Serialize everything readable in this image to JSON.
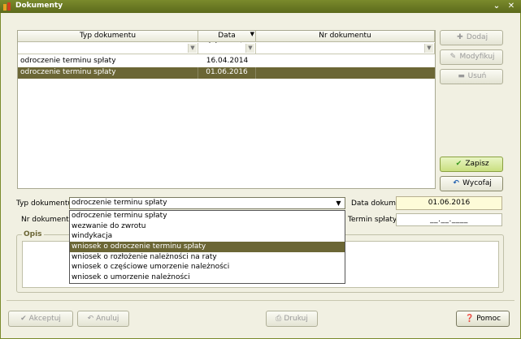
{
  "window": {
    "title": "Dokumenty",
    "minimize_glyph": "⌄",
    "close_glyph": "✕"
  },
  "grid": {
    "columns": [
      {
        "label": "Typ dokumentu",
        "sorted": false
      },
      {
        "label": "Data dokumentu",
        "sorted": true
      },
      {
        "label": "Nr dokumentu",
        "sorted": false
      }
    ],
    "rows": [
      {
        "typ": "odroczenie terminu spłaty",
        "data": "16.04.2014",
        "nr": ""
      },
      {
        "typ": "odroczenie terminu spłaty",
        "data": "01.06.2016",
        "nr": "",
        "selected": true
      }
    ]
  },
  "side_buttons": {
    "dodaj": "Dodaj",
    "modyfikuj": "Modyfikuj",
    "usun": "Usuń",
    "zapisz": "Zapisz",
    "wycofaj": "Wycofaj"
  },
  "form": {
    "typ_label": "Typ dokumentu:",
    "typ_value": "odroczenie terminu spłaty",
    "data_label": "Data dokum.:",
    "data_value": "01.06.2016",
    "nr_label": "Nr dokumentu:",
    "termin_label": "Termin spłaty:",
    "termin_value": "__.__.____",
    "opis_label": "Opis"
  },
  "dropdown_options": [
    {
      "label": "odroczenie terminu spłaty",
      "selected": false
    },
    {
      "label": "wezwanie do zwrotu",
      "selected": false
    },
    {
      "label": "windykacja",
      "selected": false
    },
    {
      "label": "wniosek o odroczenie terminu spłaty",
      "selected": true
    },
    {
      "label": "wniosek o rozłożenie należności na raty",
      "selected": false
    },
    {
      "label": "wniosek o częściowe umorzenie należności",
      "selected": false
    },
    {
      "label": "wniosek o umorzenie należności",
      "selected": false
    }
  ],
  "bottom_buttons": {
    "akceptuj": "Akceptuj",
    "anuluj": "Anuluj",
    "drukuj": "Drukuj",
    "pomoc": "Pomoc"
  }
}
